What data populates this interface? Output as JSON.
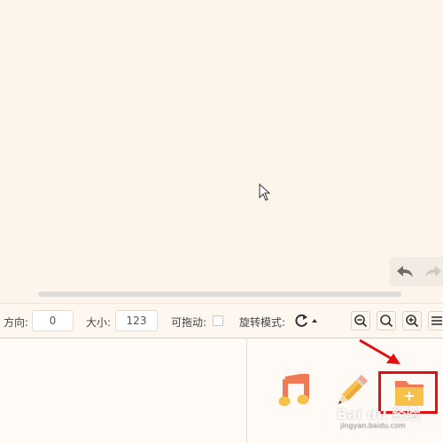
{
  "toolbar": {
    "direction_label": "方向:",
    "direction_value": "0",
    "size_label": "大小:",
    "size_value": "123",
    "draggable_label": "可拖动:",
    "rotate_mode_label": "旋转模式:"
  },
  "icons": {
    "undo": "undo-icon",
    "redo": "redo-icon",
    "rotate": "rotate-icon",
    "zoom_out": "zoom-out-icon",
    "zoom_reset": "zoom-reset-icon",
    "zoom_in": "zoom-in-icon",
    "menu": "menu-icon",
    "music": "music-icon",
    "pencil": "pencil-icon",
    "add_folder": "add-folder-icon"
  },
  "colors": {
    "background": "#fdf5eb",
    "toolbar_accent": "#f2c79a",
    "highlight": "#e01010",
    "folder": "#f5b95a",
    "music_note": "#f07a55"
  },
  "watermark": {
    "main": "Bai du 经验",
    "sub": "jingyan.baidu.com"
  }
}
